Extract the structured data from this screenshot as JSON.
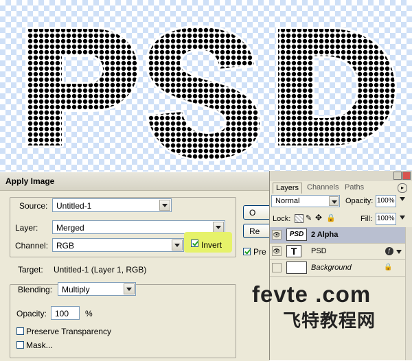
{
  "canvas": {
    "text": "PSD",
    "letters": [
      "P",
      "S",
      "D"
    ]
  },
  "dialog": {
    "title": "Apply Image",
    "source": {
      "label": "Source:",
      "value": "Untitled-1"
    },
    "layer": {
      "label": "Layer:",
      "value": "Merged"
    },
    "channel": {
      "label": "Channel:",
      "value": "RGB"
    },
    "invert": {
      "label": "Invert",
      "checked": true
    },
    "target": {
      "label": "Target:",
      "value": "Untitled-1 (Layer 1, RGB)"
    },
    "blending": {
      "label": "Blending:",
      "value": "Multiply"
    },
    "opacity": {
      "label": "Opacity:",
      "value": "100",
      "unit": "%"
    },
    "preserve_transparency": {
      "label": "Preserve Transparency",
      "checked": false
    },
    "mask": {
      "label": "Mask...",
      "checked": false
    },
    "buttons": {
      "ok": "O",
      "reset": "Re",
      "preview": "Pre"
    },
    "preview_checked": true
  },
  "layers_panel": {
    "tabs": [
      "Layers",
      "Channels",
      "Paths"
    ],
    "blend_mode": "Normal",
    "opacity_label": "Opacity:",
    "opacity_value": "100%",
    "lock_label": "Lock:",
    "fill_label": "Fill:",
    "fill_value": "100%",
    "layers": [
      {
        "name": "2 Alpha",
        "thumb": "PSD",
        "visible": true,
        "selected": true
      },
      {
        "name": "PSD",
        "thumb": "T",
        "visible": true,
        "selected": false
      },
      {
        "name": "Background",
        "thumb": "",
        "visible": false,
        "selected": false
      }
    ]
  },
  "watermark": {
    "line1": "fevte .com",
    "line2": "飞特教程网"
  },
  "colors": {
    "dialog_bg": "#ece9d8",
    "highlight": "#e6f26a",
    "checker": "#cfe0f7"
  }
}
